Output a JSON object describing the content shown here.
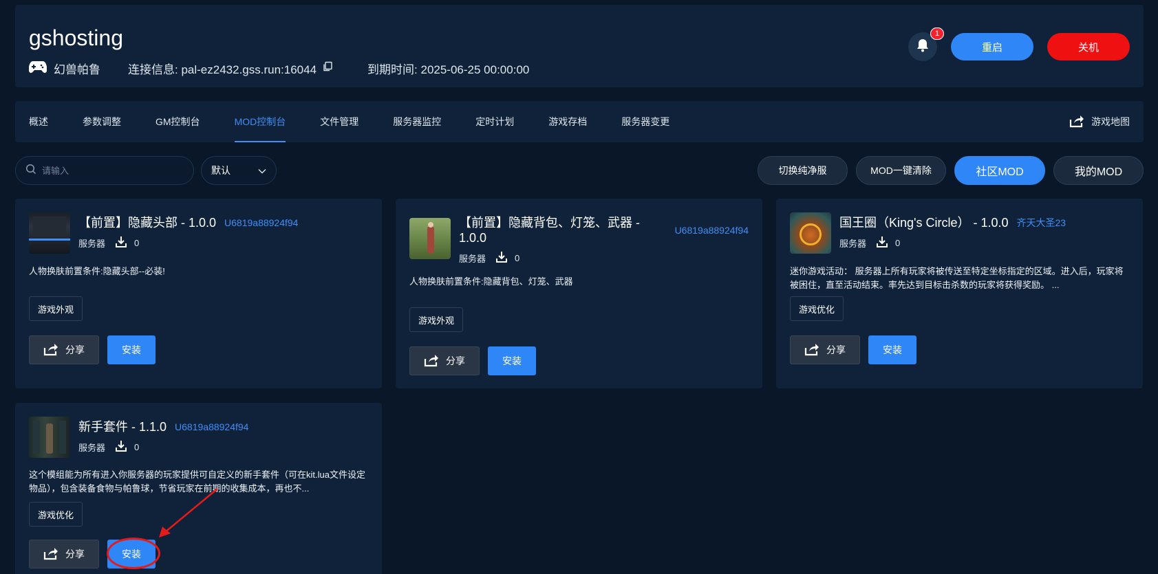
{
  "header": {
    "title": "gshosting",
    "game_name": "幻兽帕鲁",
    "connection_label": "连接信息: pal-ez2432.gss.run:16044",
    "expiry_label": "到期时间: 2025-06-25 00:00:00",
    "notification_count": "1",
    "restart_label": "重启",
    "shutdown_label": "关机"
  },
  "nav": {
    "tabs": [
      {
        "label": "概述"
      },
      {
        "label": "参数调整"
      },
      {
        "label": "GM控制台"
      },
      {
        "label": "MOD控制台",
        "active": true
      },
      {
        "label": "文件管理"
      },
      {
        "label": "服务器监控"
      },
      {
        "label": "定时计划"
      },
      {
        "label": "游戏存档"
      },
      {
        "label": "服务器变更"
      }
    ],
    "map_label": "游戏地图"
  },
  "toolbar": {
    "search_placeholder": "请输入",
    "sort_value": "默认",
    "buttons": [
      "切换纯净服",
      "MOD一键清除",
      "社区MOD",
      "我的MOD"
    ]
  },
  "cards": [
    {
      "name": "【前置】隐藏头部 - 1.0.0",
      "author": "U6819a88924f94",
      "type": "服务器",
      "downloads": "0",
      "description": "人物换肤前置条件:隐藏头部--必装!",
      "tag": "游戏外观",
      "share_label": "分享",
      "install_label": "安装"
    },
    {
      "name": "【前置】隐藏背包、灯笼、武器 - 1.0.0",
      "author": "U6819a88924f94",
      "type": "服务器",
      "downloads": "0",
      "description": "人物换肤前置条件:隐藏背包、灯笼、武器",
      "tag": "游戏外观",
      "share_label": "分享",
      "install_label": "安装"
    },
    {
      "name": "国王圈（King's Circle） - 1.0.0",
      "author": "齐天大圣23",
      "type": "服务器",
      "downloads": "0",
      "description": "迷你游戏活动： 服务器上所有玩家将被传送至特定坐标指定的区域。进入后，玩家将被困住，直至活动结束。率先达到目标击杀数的玩家将获得奖励。 ...",
      "tag": "游戏优化",
      "share_label": "分享",
      "install_label": "安装"
    },
    {
      "name": "新手套件 - 1.1.0",
      "author": "U6819a88924f94",
      "type": "服务器",
      "downloads": "0",
      "description": "这个模组能为所有进入你服务器的玩家提供可自定义的新手套件（可在kit.lua文件设定物品），包含装备食物与帕鲁球，节省玩家在前期的收集成本，再也不...",
      "tag": "游戏优化",
      "share_label": "分享",
      "install_label": "安装"
    }
  ],
  "colors": {
    "background": "#091728",
    "panel": "#0f2239",
    "accent": "#2f86f6",
    "danger": "#ef1111",
    "annotation": "#e51a1a"
  }
}
